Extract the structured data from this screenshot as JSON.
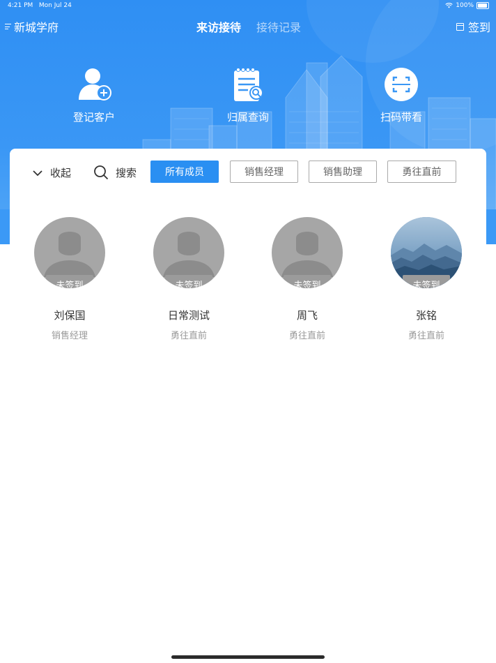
{
  "status_bar": {
    "time": "4:21 PM",
    "date": "Mon Jul 24",
    "battery": "100%"
  },
  "nav": {
    "store_name": "新城学府",
    "tabs": [
      {
        "label": "来访接待",
        "active": true
      },
      {
        "label": "接待记录",
        "active": false
      }
    ],
    "signin_label": "签到"
  },
  "quick_actions": [
    {
      "label": "登记客户",
      "icon": "add-customer-icon"
    },
    {
      "label": "归属查询",
      "icon": "notepad-search-icon"
    },
    {
      "label": "扫码带看",
      "icon": "scan-icon"
    }
  ],
  "filter": {
    "collapse_label": "收起",
    "search_label": "搜索",
    "chips": [
      {
        "label": "所有成员",
        "active": true
      },
      {
        "label": "销售经理",
        "active": false
      },
      {
        "label": "销售助理",
        "active": false
      },
      {
        "label": "勇往直前",
        "active": false
      }
    ]
  },
  "members": [
    {
      "name": "刘保国",
      "role": "销售经理",
      "status": "未签到",
      "avatar": "default-person"
    },
    {
      "name": "日常测试",
      "role": "勇往直前",
      "status": "未签到",
      "avatar": "default-person"
    },
    {
      "name": "周飞",
      "role": "勇往直前",
      "status": "未签到",
      "avatar": "default-person"
    },
    {
      "name": "张铭",
      "role": "勇往直前",
      "status": "未签到",
      "avatar": "mountain-photo"
    }
  ],
  "colors": {
    "brand_blue": "#2f8ff3",
    "chip_active": "#2a8ff2",
    "badge_gray": "#9b9b9b"
  }
}
